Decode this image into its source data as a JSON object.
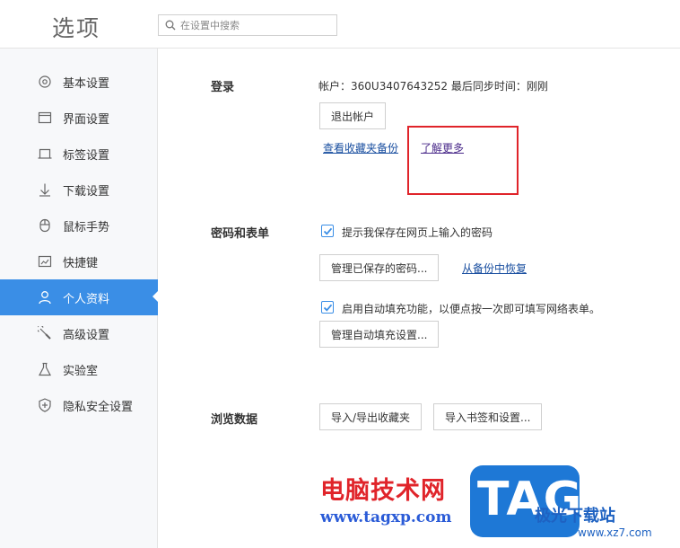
{
  "header": {
    "title": "选项",
    "search_placeholder": "在设置中搜索"
  },
  "sidebar": {
    "active_index": 6,
    "items": [
      {
        "label": "基本设置",
        "icon": "gear-icon"
      },
      {
        "label": "界面设置",
        "icon": "window-icon"
      },
      {
        "label": "标签设置",
        "icon": "tab-icon"
      },
      {
        "label": "下载设置",
        "icon": "download-icon"
      },
      {
        "label": "鼠标手势",
        "icon": "mouse-icon"
      },
      {
        "label": "快捷键",
        "icon": "keyboard-icon"
      },
      {
        "label": "个人资料",
        "icon": "user-icon"
      },
      {
        "label": "高级设置",
        "icon": "wrench-icon"
      },
      {
        "label": "实验室",
        "icon": "flask-icon"
      },
      {
        "label": "隐私安全设置",
        "icon": "shield-icon"
      }
    ]
  },
  "login": {
    "title": "登录",
    "account_info": "帐户：360U3407643252  最后同步时间：刚刚",
    "logout_button": "退出帐户",
    "view_backup_link": "查看收藏夹备份",
    "learn_more_link": "了解更多"
  },
  "password": {
    "title": "密码和表单",
    "save_password_label": "提示我保存在网页上输入的密码",
    "save_password_checked": true,
    "manage_passwords_button": "管理已保存的密码...",
    "restore_link": "从备份中恢复",
    "autofill_label": "启用自动填充功能，以便点按一次即可填写网络表单。",
    "autofill_checked": true,
    "manage_autofill_button": "管理自动填充设置..."
  },
  "browsing": {
    "title": "浏览数据",
    "import_export_button": "导入/导出收藏夹",
    "import_bookmarks_button": "导入书签和设置..."
  },
  "watermark": {
    "text": "电脑技术网",
    "url": "www.tagxp.com",
    "tag": "TAG",
    "site": "极光下载站",
    "site_url": "www.xz7.com"
  },
  "colors": {
    "accent": "#3a8ee6",
    "highlight": "#e0242a"
  }
}
